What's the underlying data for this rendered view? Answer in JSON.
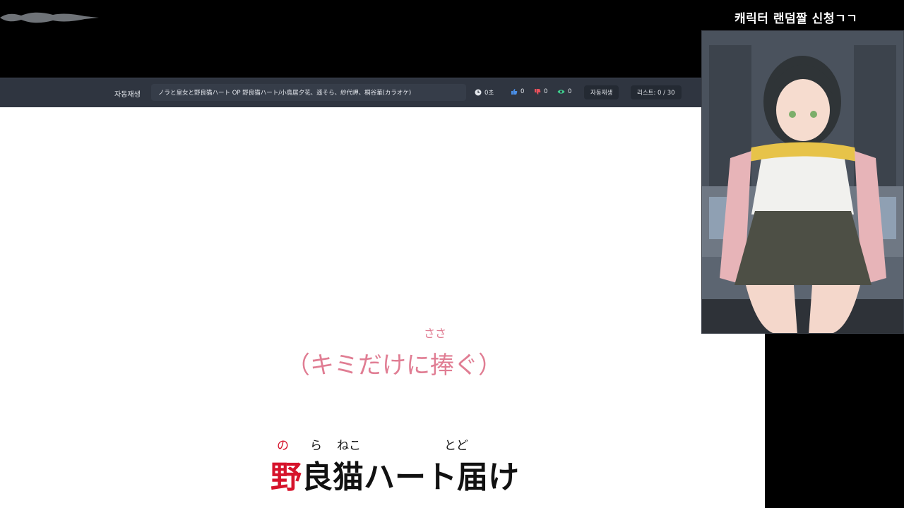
{
  "channel": {
    "title": "캐릭터 랜덤짤 신청ㄱㄱ"
  },
  "toolbar": {
    "autoplay_label": "자동재생",
    "song_title": "ノラと皇女と野良猫ハート OP 野良猫ハート/小鳥居夕花、遥そら、紗代岬、桐谷華(カラオケ)",
    "duration": "0초",
    "likes": "0",
    "dislikes": "0",
    "views": "0",
    "autoplay_button": "자동재생",
    "list_button": "리스트: 0 / 30",
    "icons": {
      "duration": "clock-icon",
      "likes": "thumbs-up-icon",
      "dislikes": "thumbs-down-icon",
      "views": "eye-icon"
    },
    "colors": {
      "like": "#4a8fe8",
      "dislike": "#e8505b",
      "view": "#3ecf8e"
    }
  },
  "lyrics": {
    "line1": "（キミだけに捧ぐ）",
    "line1_ruby": "ささ",
    "line2_sung": "野",
    "line2_rest": "良猫ハート届け",
    "line2_ruby": [
      "の",
      "ら",
      "ねこ",
      "とど"
    ],
    "colors": {
      "line1": "#e07d93",
      "sung": "#d6132b",
      "unsung": "#111111"
    }
  }
}
